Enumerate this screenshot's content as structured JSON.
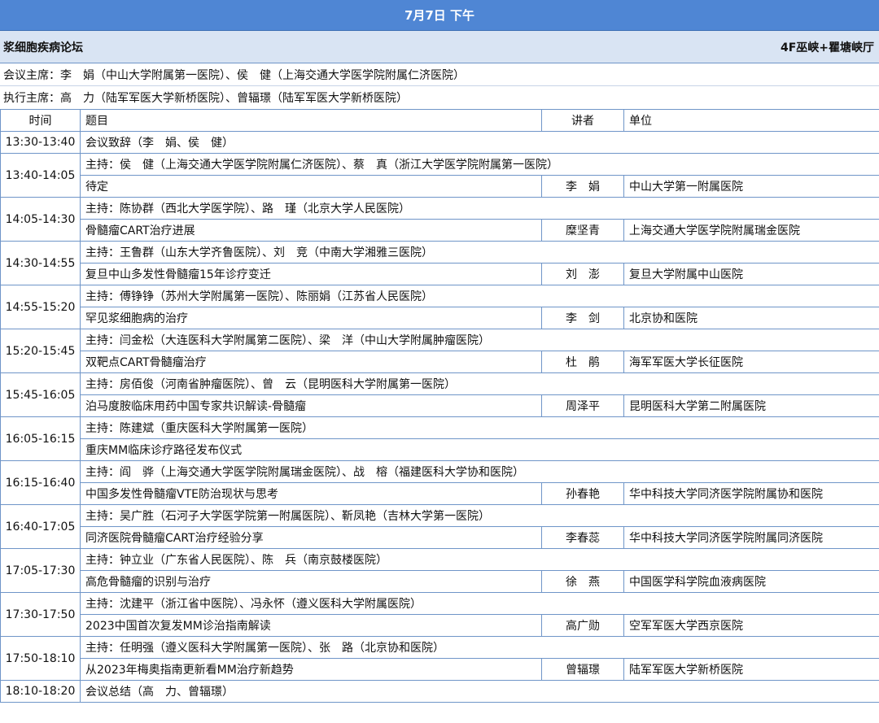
{
  "header": {
    "title": "7月7日  下午"
  },
  "forum": {
    "name": "浆细胞疾病论坛",
    "room": "4F巫峡+瞿塘峡厅"
  },
  "chairs": {
    "conference": "会议主席：李　娟（中山大学附属第一医院）、侯　健（上海交通大学医学院附属仁济医院）",
    "executive": "执行主席：高　力（陆军军医大学新桥医院）、曾辐璟（陆军军医大学新桥医院）"
  },
  "columns": {
    "time": "时间",
    "title": "题目",
    "speaker": "讲者",
    "unit": "单位"
  },
  "rows": {
    "r0": {
      "time": "13:30-13:40",
      "text": "会议致辞（李　娟、侯　健）"
    },
    "r1": {
      "time": "13:40-14:05",
      "host": "主持：侯　健（上海交通大学医学院附属仁济医院）、蔡　真（浙江大学医学院附属第一医院）",
      "title": "待定",
      "speaker": "李　娟",
      "unit": "中山大学第一附属医院"
    },
    "r2": {
      "time": "14:05-14:30",
      "host": "主持：陈协群（西北大学医学院）、路　瑾（北京大学人民医院）",
      "title": "骨髓瘤CART治疗进展",
      "speaker": "糜坚青",
      "unit": "上海交通大学医学院附属瑞金医院"
    },
    "r3": {
      "time": "14:30-14:55",
      "host": "主持：王鲁群（山东大学齐鲁医院）、刘　竞（中南大学湘雅三医院）",
      "title": "复旦中山多发性骨髓瘤15年诊疗变迁",
      "speaker": "刘　澎",
      "unit": "复旦大学附属中山医院"
    },
    "r4": {
      "time": "14:55-15:20",
      "host": "主持：傅铮铮（苏州大学附属第一医院）、陈丽娟（江苏省人民医院）",
      "title": "罕见浆细胞病的治疗",
      "speaker": "李　剑",
      "unit": "北京协和医院"
    },
    "r5": {
      "time": "15:20-15:45",
      "host": "主持：闫金松（大连医科大学附属第二医院）、梁　洋（中山大学附属肿瘤医院）",
      "title": "双靶点CART骨髓瘤治疗",
      "speaker": "杜　鹃",
      "unit": "海军军医大学长征医院"
    },
    "r6": {
      "time": "15:45-16:05",
      "host": "主持：房佰俊（河南省肿瘤医院）、曾　云（昆明医科大学附属第一医院）",
      "title": "泊马度胺临床用药中国专家共识解读-骨髓瘤",
      "speaker": "周泽平",
      "unit": "昆明医科大学第二附属医院"
    },
    "r7": {
      "time": "16:05-16:15",
      "host": "主持：陈建斌（重庆医科大学附属第一医院）",
      "title": "重庆MM临床诊疗路径发布仪式"
    },
    "r8": {
      "time": "16:15-16:40",
      "host": "主持：阎　骅（上海交通大学医学院附属瑞金医院）、战　榕（福建医科大学协和医院）",
      "title": "中国多发性骨髓瘤VTE防治现状与思考",
      "speaker": "孙春艳",
      "unit": "华中科技大学同济医学院附属协和医院"
    },
    "r9": {
      "time": "16:40-17:05",
      "host": "主持：吴广胜（石河子大学医学院第一附属医院）、靳凤艳（吉林大学第一医院）",
      "title": "同济医院骨髓瘤CART治疗经验分享",
      "speaker": "李春蕊",
      "unit": "华中科技大学同济医学院附属同济医院"
    },
    "r10": {
      "time": "17:05-17:30",
      "host": "主持：钟立业（广东省人民医院）、陈　兵（南京鼓楼医院）",
      "title": "高危骨髓瘤的识别与治疗",
      "speaker": "徐　燕",
      "unit": "中国医学科学院血液病医院"
    },
    "r11": {
      "time": "17:30-17:50",
      "host": "主持：沈建平（浙江省中医院）、冯永怀（遵义医科大学附属医院）",
      "title": "2023中国首次复发MM诊治指南解读",
      "speaker": "高广勋",
      "unit": "空军军医大学西京医院"
    },
    "r12": {
      "time": "17:50-18:10",
      "host": "主持：任明强（遵义医科大学附属第一医院）、张　路（北京协和医院）",
      "title": "从2023年梅奥指南更新看MM治疗新趋势",
      "speaker": "曾辐璟",
      "unit": "陆军军医大学新桥医院"
    },
    "r13": {
      "time": "18:10-18:20",
      "text": "会议总结（高　力、曾辐璟）"
    }
  }
}
